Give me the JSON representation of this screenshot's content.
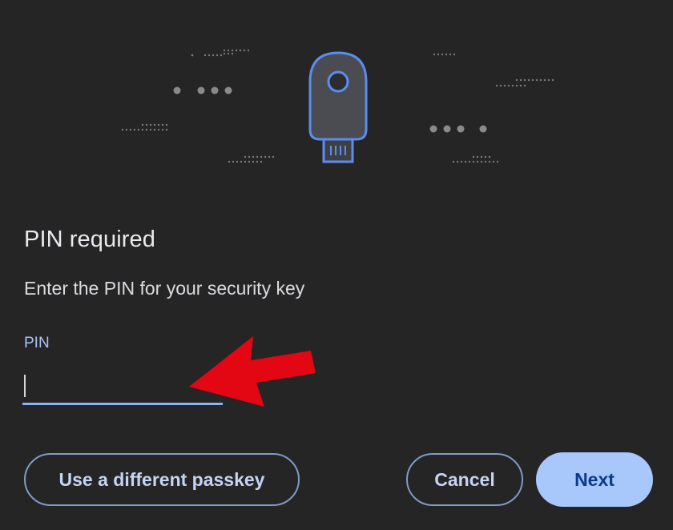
{
  "dialog": {
    "title": "PIN required",
    "subtitle": "Enter the PIN for your security key"
  },
  "pin_field": {
    "label": "PIN",
    "value": ""
  },
  "buttons": {
    "different_passkey": "Use a different passkey",
    "cancel": "Cancel",
    "next": "Next"
  },
  "icons": {
    "security_key": "security-key-icon",
    "annotation": "red-arrow-icon"
  },
  "colors": {
    "background": "#252526",
    "accent": "#8ab4f8",
    "primary_button": "#a8c7fa",
    "arrow": "#e30613"
  }
}
